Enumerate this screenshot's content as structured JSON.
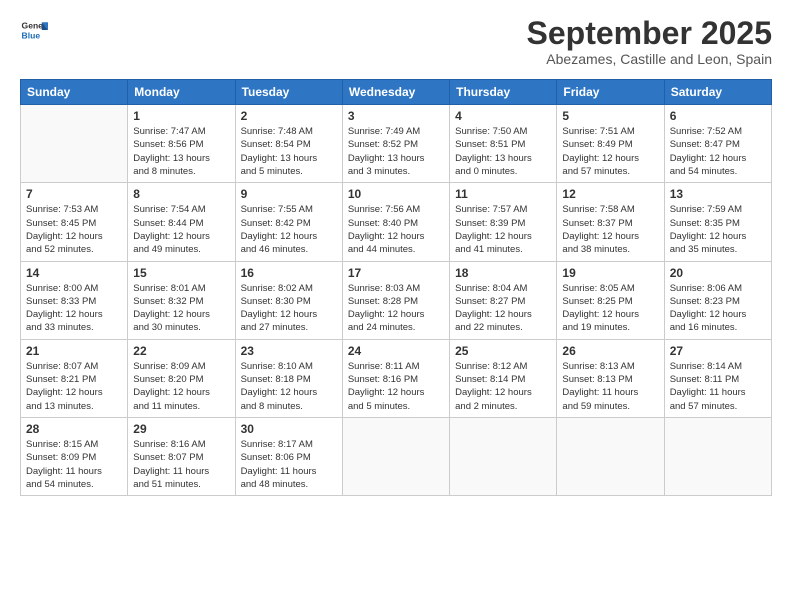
{
  "logo": {
    "line1": "General",
    "line2": "Blue"
  },
  "title": "September 2025",
  "subtitle": "Abezames, Castille and Leon, Spain",
  "weekdays": [
    "Sunday",
    "Monday",
    "Tuesday",
    "Wednesday",
    "Thursday",
    "Friday",
    "Saturday"
  ],
  "weeks": [
    [
      {
        "day": "",
        "info": ""
      },
      {
        "day": "1",
        "info": "Sunrise: 7:47 AM\nSunset: 8:56 PM\nDaylight: 13 hours\nand 8 minutes."
      },
      {
        "day": "2",
        "info": "Sunrise: 7:48 AM\nSunset: 8:54 PM\nDaylight: 13 hours\nand 5 minutes."
      },
      {
        "day": "3",
        "info": "Sunrise: 7:49 AM\nSunset: 8:52 PM\nDaylight: 13 hours\nand 3 minutes."
      },
      {
        "day": "4",
        "info": "Sunrise: 7:50 AM\nSunset: 8:51 PM\nDaylight: 13 hours\nand 0 minutes."
      },
      {
        "day": "5",
        "info": "Sunrise: 7:51 AM\nSunset: 8:49 PM\nDaylight: 12 hours\nand 57 minutes."
      },
      {
        "day": "6",
        "info": "Sunrise: 7:52 AM\nSunset: 8:47 PM\nDaylight: 12 hours\nand 54 minutes."
      }
    ],
    [
      {
        "day": "7",
        "info": "Sunrise: 7:53 AM\nSunset: 8:45 PM\nDaylight: 12 hours\nand 52 minutes."
      },
      {
        "day": "8",
        "info": "Sunrise: 7:54 AM\nSunset: 8:44 PM\nDaylight: 12 hours\nand 49 minutes."
      },
      {
        "day": "9",
        "info": "Sunrise: 7:55 AM\nSunset: 8:42 PM\nDaylight: 12 hours\nand 46 minutes."
      },
      {
        "day": "10",
        "info": "Sunrise: 7:56 AM\nSunset: 8:40 PM\nDaylight: 12 hours\nand 44 minutes."
      },
      {
        "day": "11",
        "info": "Sunrise: 7:57 AM\nSunset: 8:39 PM\nDaylight: 12 hours\nand 41 minutes."
      },
      {
        "day": "12",
        "info": "Sunrise: 7:58 AM\nSunset: 8:37 PM\nDaylight: 12 hours\nand 38 minutes."
      },
      {
        "day": "13",
        "info": "Sunrise: 7:59 AM\nSunset: 8:35 PM\nDaylight: 12 hours\nand 35 minutes."
      }
    ],
    [
      {
        "day": "14",
        "info": "Sunrise: 8:00 AM\nSunset: 8:33 PM\nDaylight: 12 hours\nand 33 minutes."
      },
      {
        "day": "15",
        "info": "Sunrise: 8:01 AM\nSunset: 8:32 PM\nDaylight: 12 hours\nand 30 minutes."
      },
      {
        "day": "16",
        "info": "Sunrise: 8:02 AM\nSunset: 8:30 PM\nDaylight: 12 hours\nand 27 minutes."
      },
      {
        "day": "17",
        "info": "Sunrise: 8:03 AM\nSunset: 8:28 PM\nDaylight: 12 hours\nand 24 minutes."
      },
      {
        "day": "18",
        "info": "Sunrise: 8:04 AM\nSunset: 8:27 PM\nDaylight: 12 hours\nand 22 minutes."
      },
      {
        "day": "19",
        "info": "Sunrise: 8:05 AM\nSunset: 8:25 PM\nDaylight: 12 hours\nand 19 minutes."
      },
      {
        "day": "20",
        "info": "Sunrise: 8:06 AM\nSunset: 8:23 PM\nDaylight: 12 hours\nand 16 minutes."
      }
    ],
    [
      {
        "day": "21",
        "info": "Sunrise: 8:07 AM\nSunset: 8:21 PM\nDaylight: 12 hours\nand 13 minutes."
      },
      {
        "day": "22",
        "info": "Sunrise: 8:09 AM\nSunset: 8:20 PM\nDaylight: 12 hours\nand 11 minutes."
      },
      {
        "day": "23",
        "info": "Sunrise: 8:10 AM\nSunset: 8:18 PM\nDaylight: 12 hours\nand 8 minutes."
      },
      {
        "day": "24",
        "info": "Sunrise: 8:11 AM\nSunset: 8:16 PM\nDaylight: 12 hours\nand 5 minutes."
      },
      {
        "day": "25",
        "info": "Sunrise: 8:12 AM\nSunset: 8:14 PM\nDaylight: 12 hours\nand 2 minutes."
      },
      {
        "day": "26",
        "info": "Sunrise: 8:13 AM\nSunset: 8:13 PM\nDaylight: 11 hours\nand 59 minutes."
      },
      {
        "day": "27",
        "info": "Sunrise: 8:14 AM\nSunset: 8:11 PM\nDaylight: 11 hours\nand 57 minutes."
      }
    ],
    [
      {
        "day": "28",
        "info": "Sunrise: 8:15 AM\nSunset: 8:09 PM\nDaylight: 11 hours\nand 54 minutes."
      },
      {
        "day": "29",
        "info": "Sunrise: 8:16 AM\nSunset: 8:07 PM\nDaylight: 11 hours\nand 51 minutes."
      },
      {
        "day": "30",
        "info": "Sunrise: 8:17 AM\nSunset: 8:06 PM\nDaylight: 11 hours\nand 48 minutes."
      },
      {
        "day": "",
        "info": ""
      },
      {
        "day": "",
        "info": ""
      },
      {
        "day": "",
        "info": ""
      },
      {
        "day": "",
        "info": ""
      }
    ]
  ]
}
